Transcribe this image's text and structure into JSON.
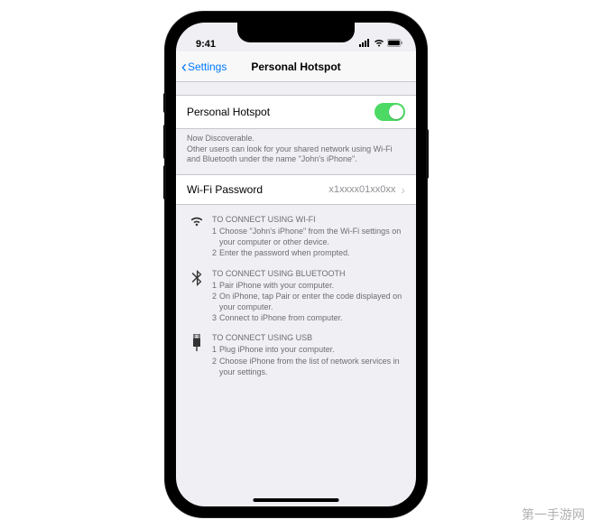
{
  "statusbar": {
    "time": "9:41"
  },
  "nav": {
    "back": "Settings",
    "title": "Personal Hotspot"
  },
  "hotspot": {
    "label": "Personal Hotspot",
    "enabled": true
  },
  "helper": {
    "line1": "Now Discoverable.",
    "line2": "Other users can look for your shared network using Wi-Fi and Bluetooth under the name \"John's iPhone\"."
  },
  "wifi_password": {
    "label": "Wi-Fi Password",
    "value": "x1xxxx01xx0xx"
  },
  "instructions": {
    "wifi": {
      "heading": "TO CONNECT USING WI-FI",
      "steps": [
        "Choose \"John's iPhone\" from the Wi-Fi settings on your computer or other device.",
        "Enter the password when prompted."
      ]
    },
    "bluetooth": {
      "heading": "TO CONNECT USING BLUETOOTH",
      "steps": [
        "Pair iPhone with your computer.",
        "On iPhone, tap Pair or enter the code displayed on your computer.",
        "Connect to iPhone from computer."
      ]
    },
    "usb": {
      "heading": "TO CONNECT USING USB",
      "steps": [
        "Plug iPhone into your computer.",
        "Choose iPhone from the list of network services in your settings."
      ]
    }
  },
  "watermark": "第一手游网"
}
